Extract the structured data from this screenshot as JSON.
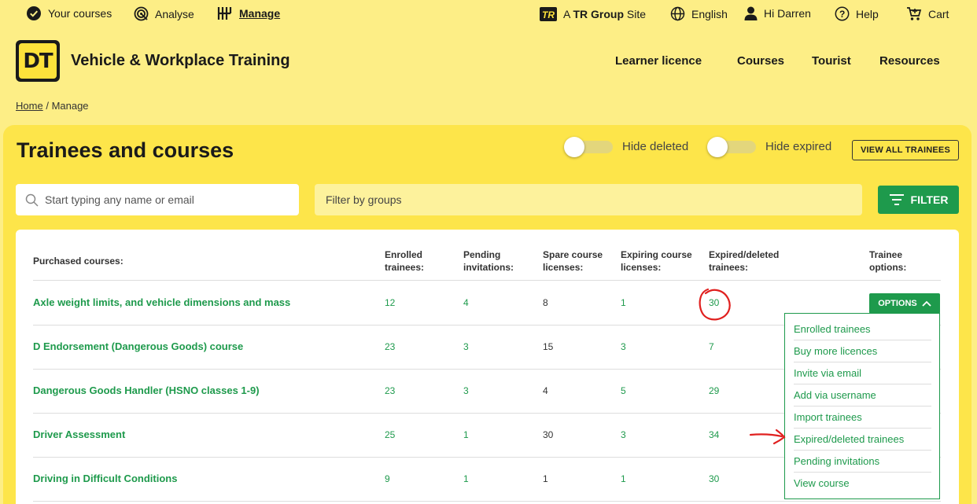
{
  "topbar": {
    "your_courses": "Your courses",
    "analyse": "Analyse",
    "manage": "Manage",
    "site_prefix": "A",
    "site_brand": "TR Group",
    "site_suffix": "Site",
    "language": "English",
    "greeting": "Hi Darren",
    "help": "Help",
    "cart": "Cart"
  },
  "header": {
    "logo_text": "DT",
    "site_title": "Vehicle & Workplace Training",
    "nav": [
      "Learner licence",
      "Courses",
      "Tourist",
      "Resources"
    ]
  },
  "breadcrumb": {
    "home": "Home",
    "separator": "/",
    "current": "Manage"
  },
  "page": {
    "title": "Trainees and courses",
    "hide_deleted": "Hide deleted",
    "hide_expired": "Hide expired",
    "view_all": "VIEW ALL TRAINEES",
    "search_placeholder": "Start typing any name or email",
    "groups_placeholder": "Filter by groups",
    "filter_label": "FILTER"
  },
  "table": {
    "headers": {
      "course": "Purchased courses:",
      "enrolled": [
        "Enrolled",
        "trainees:"
      ],
      "pending": [
        "Pending",
        "invitations:"
      ],
      "spare": [
        "Spare course",
        "licenses:"
      ],
      "expiring": [
        "Expiring course",
        "licenses:"
      ],
      "expired": [
        "Expired/deleted",
        "trainees:"
      ],
      "options": [
        "Trainee",
        "options:"
      ]
    },
    "rows": [
      {
        "course": "Axle weight limits, and vehicle dimensions and mass",
        "enrolled": "12",
        "pending": "4",
        "spare": "8",
        "expiring": "1",
        "expired": "30"
      },
      {
        "course": "D Endorsement (Dangerous Goods) course",
        "enrolled": "23",
        "pending": "3",
        "spare": "15",
        "expiring": "3",
        "expired": "7"
      },
      {
        "course": "Dangerous Goods Handler (HSNO classes 1-9)",
        "enrolled": "23",
        "pending": "3",
        "spare": "4",
        "expiring": "5",
        "expired": "29"
      },
      {
        "course": "Driver Assessment",
        "enrolled": "25",
        "pending": "1",
        "spare": "30",
        "expiring": "3",
        "expired": "34"
      },
      {
        "course": "Driving in Difficult Conditions",
        "enrolled": "9",
        "pending": "1",
        "spare": "1",
        "expiring": "1",
        "expired": "30"
      }
    ],
    "options_button": "OPTIONS",
    "options_menu": [
      "Enrolled trainees",
      "Buy more licences",
      "Invite via email",
      "Add via username",
      "Import trainees",
      "Expired/deleted trainees",
      "Pending invitations",
      "View course"
    ]
  },
  "colors": {
    "background": "#fdee86",
    "panel": "#fde54a",
    "accent_green": "#1e9a4c",
    "annotation_red": "#e0201f"
  }
}
